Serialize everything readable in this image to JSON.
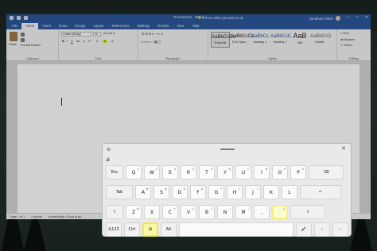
{
  "word": {
    "title": "Document1 - Word",
    "search_placeholder": "Tell me what you want to do",
    "user_name": "Jonathan Fisher",
    "window_controls": [
      "—",
      "□",
      "✕"
    ],
    "tabs": [
      "File",
      "Home",
      "Insert",
      "Draw",
      "Design",
      "Layout",
      "References",
      "Mailings",
      "Review",
      "View",
      "Help"
    ],
    "active_tab": "Home",
    "ribbon": {
      "clipboard": {
        "paste": "Paste",
        "format_painter": "Format Painter",
        "label": "Clipboard"
      },
      "font": {
        "name": "Calibri (Body)",
        "size": "11",
        "label": "Font"
      },
      "paragraph": {
        "label": "Paragraph"
      },
      "styles": {
        "label": "Styles",
        "items": [
          {
            "preview": "AaBbCcDc",
            "name": "¶ Normal"
          },
          {
            "preview": "AaBbCcDc",
            "name": "¶ No Spac..."
          },
          {
            "preview": "AaBbCc",
            "name": "Heading 1"
          },
          {
            "preview": "AaBbCcE",
            "name": "Heading 2"
          },
          {
            "preview": "AaB",
            "name": "Title"
          },
          {
            "preview": "AaBbCcD",
            "name": "Subtitle"
          }
        ]
      },
      "editing": {
        "find": "Find",
        "replace": "Replace",
        "select": "Select",
        "label": "Editing"
      }
    },
    "status": {
      "page": "Page 1 of 1",
      "words": "0 words",
      "accessibility": "Accessibility: Good to go"
    }
  },
  "keyboard": {
    "rows": [
      [
        {
          "label": "Esc"
        },
        {
          "label": "Q",
          "sub": "1"
        },
        {
          "label": "W",
          "sub": "2"
        },
        {
          "label": "E",
          "sub": "3"
        },
        {
          "label": "R",
          "sub": "4"
        },
        {
          "label": "T",
          "sub": "5"
        },
        {
          "label": "Y",
          "sub": "6"
        },
        {
          "label": "U",
          "sub": "7"
        },
        {
          "label": "I",
          "sub": "8"
        },
        {
          "label": "O",
          "sub": "9"
        },
        {
          "label": "P",
          "sub": "0"
        },
        {
          "label": "⌫"
        }
      ],
      [
        {
          "label": "Tab"
        },
        {
          "label": "A",
          "sub": "@"
        },
        {
          "label": "S",
          "sub": "#"
        },
        {
          "label": "D",
          "sub": "$"
        },
        {
          "label": "F",
          "sub": "&"
        },
        {
          "label": "G",
          "sub": "*"
        },
        {
          "label": "H",
          "sub": "("
        },
        {
          "label": "J",
          "sub": ")"
        },
        {
          "label": "K",
          "sub": "'"
        },
        {
          "label": "L",
          "sub": "\""
        },
        {
          "label": "↵"
        }
      ],
      [
        {
          "label": "⇧"
        },
        {
          "label": "Z",
          "sub": "%"
        },
        {
          "label": "X",
          "sub": "-"
        },
        {
          "label": "C",
          "sub": "+"
        },
        {
          "label": "V",
          "sub": "="
        },
        {
          "label": "B",
          "sub": "/"
        },
        {
          "label": "N",
          "sub": ";"
        },
        {
          "label": "M",
          "sub": ":"
        },
        {
          "label": ",",
          "sub": "!"
        },
        {
          "label": ".",
          "sub": "?"
        },
        {
          "label": "⇧"
        }
      ],
      [
        {
          "label": "&123"
        },
        {
          "label": "Ctrl"
        },
        {
          "label": "⊞"
        },
        {
          "label": "Alt"
        },
        {
          "label": ""
        },
        {
          "label": "🎤"
        },
        {
          "label": "‹"
        },
        {
          "label": "›"
        }
      ]
    ]
  }
}
